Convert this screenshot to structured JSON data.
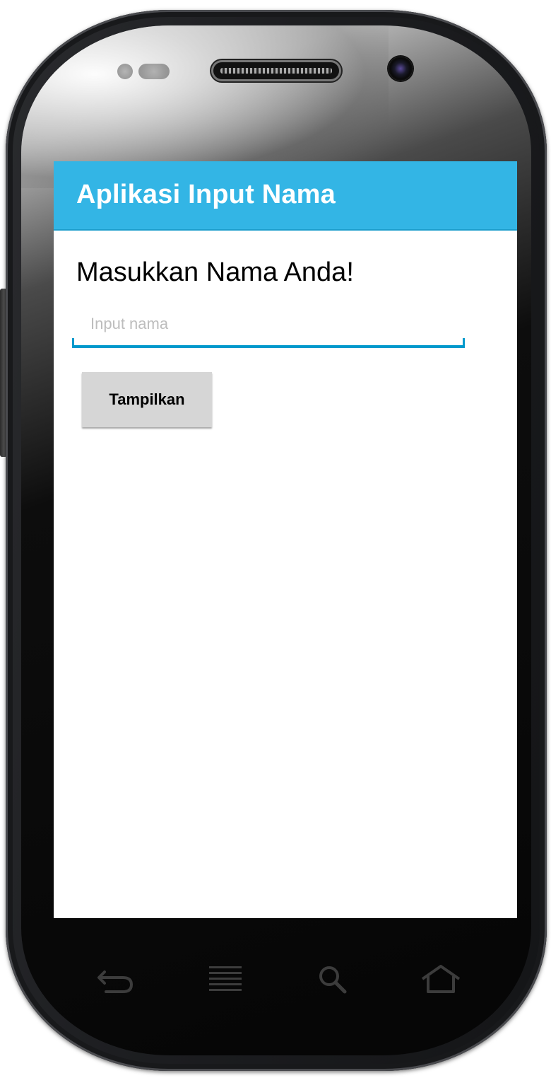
{
  "app": {
    "title": "Aplikasi Input Nama"
  },
  "main": {
    "prompt": "Masukkan Nama Anda!",
    "name_input": {
      "placeholder": "Input nama",
      "value": ""
    },
    "show_button_label": "Tampilkan"
  },
  "navbar": {
    "icons": [
      "back-icon",
      "menu-icon",
      "search-icon",
      "home-icon"
    ]
  },
  "colors": {
    "action_bar": "#33b5e5",
    "input_underline": "#0099cc",
    "button_bg": "#d6d6d6"
  }
}
